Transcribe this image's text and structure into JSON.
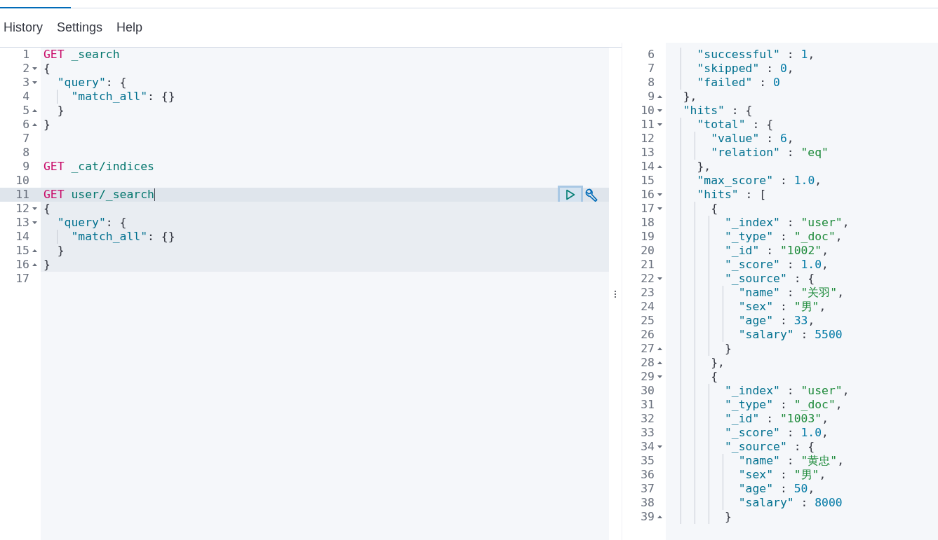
{
  "menu": [
    {
      "label": "History"
    },
    {
      "label": "Settings"
    },
    {
      "label": "Help"
    }
  ],
  "request_editor": {
    "lines": [
      {
        "number": "1",
        "tokens": [
          {
            "kind": "method",
            "text": "GET"
          },
          {
            "kind": "url",
            "text": " _search"
          }
        ]
      },
      {
        "number": "2",
        "fold_open": true,
        "tokens": [
          {
            "kind": "punct",
            "text": "{"
          }
        ]
      },
      {
        "number": "3",
        "fold_open": true,
        "tokens": [
          {
            "kind": "key",
            "text": "  \"query\""
          },
          {
            "kind": "punct",
            "text": ": {"
          }
        ]
      },
      {
        "number": "4",
        "tokens": [
          {
            "kind": "key",
            "text": "    \"match_all\""
          },
          {
            "kind": "punct",
            "text": ": {}"
          }
        ]
      },
      {
        "number": "5",
        "fold_close": true,
        "tokens": [
          {
            "kind": "punct",
            "text": "  }"
          }
        ]
      },
      {
        "number": "6",
        "fold_close": true,
        "tokens": [
          {
            "kind": "punct",
            "text": "}"
          }
        ]
      },
      {
        "number": "7"
      },
      {
        "number": "8"
      },
      {
        "number": "9",
        "tokens": [
          {
            "kind": "method",
            "text": "GET"
          },
          {
            "kind": "url",
            "text": " _cat/indices"
          }
        ]
      },
      {
        "number": "10"
      },
      {
        "number": "11",
        "active": true,
        "in_request": true,
        "cursor": true,
        "tokens": [
          {
            "kind": "method",
            "text": "GET"
          },
          {
            "kind": "url",
            "text": " user/_search"
          }
        ]
      },
      {
        "number": "12",
        "in_request": true,
        "fold_open": true,
        "tokens": [
          {
            "kind": "punct",
            "text": "{"
          }
        ]
      },
      {
        "number": "13",
        "in_request": true,
        "fold_open": true,
        "tokens": [
          {
            "kind": "key",
            "text": "  \"query\""
          },
          {
            "kind": "punct",
            "text": ": {"
          }
        ]
      },
      {
        "number": "14",
        "in_request": true,
        "tokens": [
          {
            "kind": "key",
            "text": "    \"match_all\""
          },
          {
            "kind": "punct",
            "text": ": {}"
          }
        ]
      },
      {
        "number": "15",
        "in_request": true,
        "fold_close": true,
        "tokens": [
          {
            "kind": "punct",
            "text": "  }"
          }
        ]
      },
      {
        "number": "16",
        "in_request": true,
        "fold_close": true,
        "tokens": [
          {
            "kind": "punct",
            "text": "}"
          }
        ]
      },
      {
        "number": "17"
      }
    ]
  },
  "response_editor": {
    "lines": [
      {
        "number": "6",
        "tokens": [
          {
            "kind": "key",
            "text": "    \"successful\""
          },
          {
            "kind": "punct",
            "text": " : "
          },
          {
            "kind": "number",
            "text": "1"
          },
          {
            "kind": "punct",
            "text": ","
          }
        ]
      },
      {
        "number": "7",
        "tokens": [
          {
            "kind": "key",
            "text": "    \"skipped\""
          },
          {
            "kind": "punct",
            "text": " : "
          },
          {
            "kind": "number",
            "text": "0"
          },
          {
            "kind": "punct",
            "text": ","
          }
        ]
      },
      {
        "number": "8",
        "tokens": [
          {
            "kind": "key",
            "text": "    \"failed\""
          },
          {
            "kind": "punct",
            "text": " : "
          },
          {
            "kind": "number",
            "text": "0"
          }
        ]
      },
      {
        "number": "9",
        "fold_close": true,
        "tokens": [
          {
            "kind": "punct",
            "text": "  },"
          }
        ]
      },
      {
        "number": "10",
        "fold_open": true,
        "tokens": [
          {
            "kind": "key",
            "text": "  \"hits\""
          },
          {
            "kind": "punct",
            "text": " : {"
          }
        ]
      },
      {
        "number": "11",
        "fold_open": true,
        "tokens": [
          {
            "kind": "key",
            "text": "    \"total\""
          },
          {
            "kind": "punct",
            "text": " : {"
          }
        ]
      },
      {
        "number": "12",
        "tokens": [
          {
            "kind": "key",
            "text": "      \"value\""
          },
          {
            "kind": "punct",
            "text": " : "
          },
          {
            "kind": "number",
            "text": "6"
          },
          {
            "kind": "punct",
            "text": ","
          }
        ]
      },
      {
        "number": "13",
        "tokens": [
          {
            "kind": "key",
            "text": "      \"relation\""
          },
          {
            "kind": "punct",
            "text": " : "
          },
          {
            "kind": "string",
            "text": "\"eq\""
          }
        ]
      },
      {
        "number": "14",
        "fold_close": true,
        "tokens": [
          {
            "kind": "punct",
            "text": "    },"
          }
        ]
      },
      {
        "number": "15",
        "tokens": [
          {
            "kind": "key",
            "text": "    \"max_score\""
          },
          {
            "kind": "punct",
            "text": " : "
          },
          {
            "kind": "number",
            "text": "1.0"
          },
          {
            "kind": "punct",
            "text": ","
          }
        ]
      },
      {
        "number": "16",
        "fold_open": true,
        "tokens": [
          {
            "kind": "key",
            "text": "    \"hits\""
          },
          {
            "kind": "punct",
            "text": " : ["
          }
        ]
      },
      {
        "number": "17",
        "fold_open": true,
        "tokens": [
          {
            "kind": "punct",
            "text": "      {"
          }
        ]
      },
      {
        "number": "18",
        "tokens": [
          {
            "kind": "key",
            "text": "        \"_index\""
          },
          {
            "kind": "punct",
            "text": " : "
          },
          {
            "kind": "string",
            "text": "\"user\""
          },
          {
            "kind": "punct",
            "text": ","
          }
        ]
      },
      {
        "number": "19",
        "tokens": [
          {
            "kind": "key",
            "text": "        \"_type\""
          },
          {
            "kind": "punct",
            "text": " : "
          },
          {
            "kind": "string",
            "text": "\"_doc\""
          },
          {
            "kind": "punct",
            "text": ","
          }
        ]
      },
      {
        "number": "20",
        "tokens": [
          {
            "kind": "key",
            "text": "        \"_id\""
          },
          {
            "kind": "punct",
            "text": " : "
          },
          {
            "kind": "string",
            "text": "\"1002\""
          },
          {
            "kind": "punct",
            "text": ","
          }
        ]
      },
      {
        "number": "21",
        "tokens": [
          {
            "kind": "key",
            "text": "        \"_score\""
          },
          {
            "kind": "punct",
            "text": " : "
          },
          {
            "kind": "number",
            "text": "1.0"
          },
          {
            "kind": "punct",
            "text": ","
          }
        ]
      },
      {
        "number": "22",
        "fold_open": true,
        "tokens": [
          {
            "kind": "key",
            "text": "        \"_source\""
          },
          {
            "kind": "punct",
            "text": " : {"
          }
        ]
      },
      {
        "number": "23",
        "tokens": [
          {
            "kind": "key",
            "text": "          \"name\""
          },
          {
            "kind": "punct",
            "text": " : "
          },
          {
            "kind": "string",
            "text": "\"关羽\""
          },
          {
            "kind": "punct",
            "text": ","
          }
        ]
      },
      {
        "number": "24",
        "tokens": [
          {
            "kind": "key",
            "text": "          \"sex\""
          },
          {
            "kind": "punct",
            "text": " : "
          },
          {
            "kind": "string",
            "text": "\"男\""
          },
          {
            "kind": "punct",
            "text": ","
          }
        ]
      },
      {
        "number": "25",
        "tokens": [
          {
            "kind": "key",
            "text": "          \"age\""
          },
          {
            "kind": "punct",
            "text": " : "
          },
          {
            "kind": "number",
            "text": "33"
          },
          {
            "kind": "punct",
            "text": ","
          }
        ]
      },
      {
        "number": "26",
        "tokens": [
          {
            "kind": "key",
            "text": "          \"salary\""
          },
          {
            "kind": "punct",
            "text": " : "
          },
          {
            "kind": "number",
            "text": "5500"
          }
        ]
      },
      {
        "number": "27",
        "fold_close": true,
        "tokens": [
          {
            "kind": "punct",
            "text": "        }"
          }
        ]
      },
      {
        "number": "28",
        "fold_close": true,
        "tokens": [
          {
            "kind": "punct",
            "text": "      },"
          }
        ]
      },
      {
        "number": "29",
        "fold_open": true,
        "tokens": [
          {
            "kind": "punct",
            "text": "      {"
          }
        ]
      },
      {
        "number": "30",
        "tokens": [
          {
            "kind": "key",
            "text": "        \"_index\""
          },
          {
            "kind": "punct",
            "text": " : "
          },
          {
            "kind": "string",
            "text": "\"user\""
          },
          {
            "kind": "punct",
            "text": ","
          }
        ]
      },
      {
        "number": "31",
        "tokens": [
          {
            "kind": "key",
            "text": "        \"_type\""
          },
          {
            "kind": "punct",
            "text": " : "
          },
          {
            "kind": "string",
            "text": "\"_doc\""
          },
          {
            "kind": "punct",
            "text": ","
          }
        ]
      },
      {
        "number": "32",
        "tokens": [
          {
            "kind": "key",
            "text": "        \"_id\""
          },
          {
            "kind": "punct",
            "text": " : "
          },
          {
            "kind": "string",
            "text": "\"1003\""
          },
          {
            "kind": "punct",
            "text": ","
          }
        ]
      },
      {
        "number": "33",
        "tokens": [
          {
            "kind": "key",
            "text": "        \"_score\""
          },
          {
            "kind": "punct",
            "text": " : "
          },
          {
            "kind": "number",
            "text": "1.0"
          },
          {
            "kind": "punct",
            "text": ","
          }
        ]
      },
      {
        "number": "34",
        "fold_open": true,
        "tokens": [
          {
            "kind": "key",
            "text": "        \"_source\""
          },
          {
            "kind": "punct",
            "text": " : {"
          }
        ]
      },
      {
        "number": "35",
        "tokens": [
          {
            "kind": "key",
            "text": "          \"name\""
          },
          {
            "kind": "punct",
            "text": " : "
          },
          {
            "kind": "string",
            "text": "\"黄忠\""
          },
          {
            "kind": "punct",
            "text": ","
          }
        ]
      },
      {
        "number": "36",
        "tokens": [
          {
            "kind": "key",
            "text": "          \"sex\""
          },
          {
            "kind": "punct",
            "text": " : "
          },
          {
            "kind": "string",
            "text": "\"男\""
          },
          {
            "kind": "punct",
            "text": ","
          }
        ]
      },
      {
        "number": "37",
        "tokens": [
          {
            "kind": "key",
            "text": "          \"age\""
          },
          {
            "kind": "punct",
            "text": " : "
          },
          {
            "kind": "number",
            "text": "50"
          },
          {
            "kind": "punct",
            "text": ","
          }
        ]
      },
      {
        "number": "38",
        "tokens": [
          {
            "kind": "key",
            "text": "          \"salary\""
          },
          {
            "kind": "punct",
            "text": " : "
          },
          {
            "kind": "number",
            "text": "8000"
          }
        ]
      },
      {
        "number": "39",
        "fold_close": true,
        "tokens": [
          {
            "kind": "punct",
            "text": "        }"
          }
        ]
      }
    ]
  }
}
